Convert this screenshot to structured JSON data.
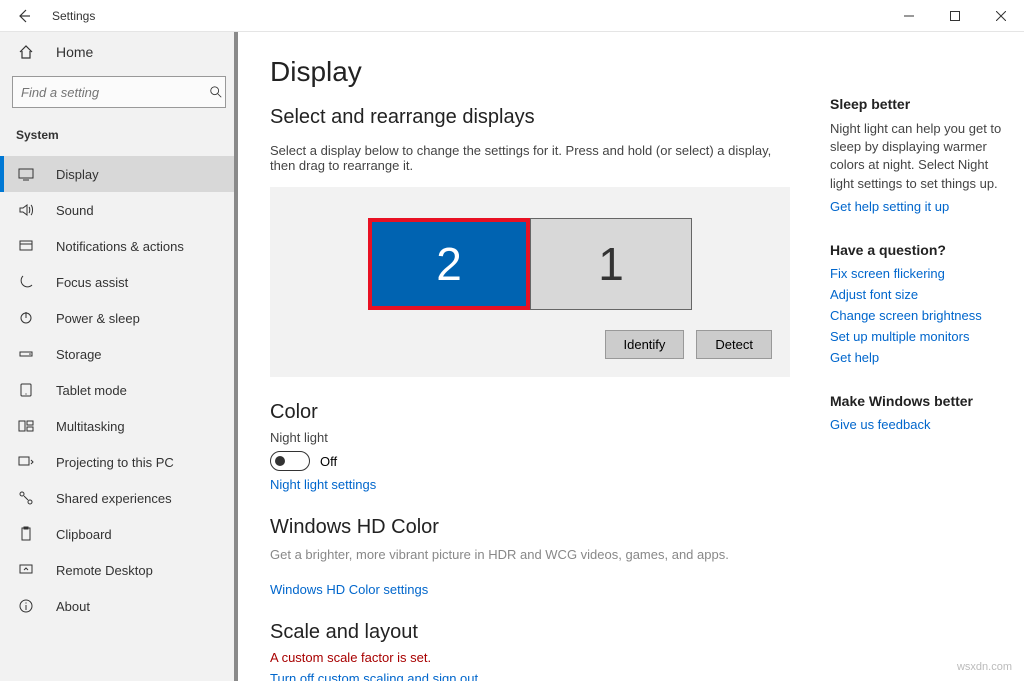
{
  "window": {
    "title": "Settings"
  },
  "sidebar": {
    "home": "Home",
    "search_placeholder": "Find a setting",
    "section": "System",
    "items": [
      {
        "label": "Display"
      },
      {
        "label": "Sound"
      },
      {
        "label": "Notifications & actions"
      },
      {
        "label": "Focus assist"
      },
      {
        "label": "Power & sleep"
      },
      {
        "label": "Storage"
      },
      {
        "label": "Tablet mode"
      },
      {
        "label": "Multitasking"
      },
      {
        "label": "Projecting to this PC"
      },
      {
        "label": "Shared experiences"
      },
      {
        "label": "Clipboard"
      },
      {
        "label": "Remote Desktop"
      },
      {
        "label": "About"
      }
    ]
  },
  "main": {
    "title": "Display",
    "arrange_heading": "Select and rearrange displays",
    "arrange_desc": "Select a display below to change the settings for it. Press and hold (or select) a display, then drag to rearrange it.",
    "display_selected": "2",
    "display_other": "1",
    "identify": "Identify",
    "detect": "Detect",
    "color_heading": "Color",
    "night_light_label": "Night light",
    "night_light_state": "Off",
    "night_light_link": "Night light settings",
    "hd_heading": "Windows HD Color",
    "hd_desc": "Get a brighter, more vibrant picture in HDR and WCG videos, games, and apps.",
    "hd_link": "Windows HD Color settings",
    "scale_heading": "Scale and layout",
    "scale_warning": "A custom scale factor is set.",
    "scale_link": "Turn off custom scaling and sign out"
  },
  "right": {
    "sleep": {
      "heading": "Sleep better",
      "text": "Night light can help you get to sleep by displaying warmer colors at night. Select Night light settings to set things up.",
      "link": "Get help setting it up"
    },
    "question": {
      "heading": "Have a question?",
      "links": [
        "Fix screen flickering",
        "Adjust font size",
        "Change screen brightness",
        "Set up multiple monitors",
        "Get help"
      ]
    },
    "feedback": {
      "heading": "Make Windows better",
      "link": "Give us feedback"
    }
  },
  "footer": "wsxdn.com"
}
